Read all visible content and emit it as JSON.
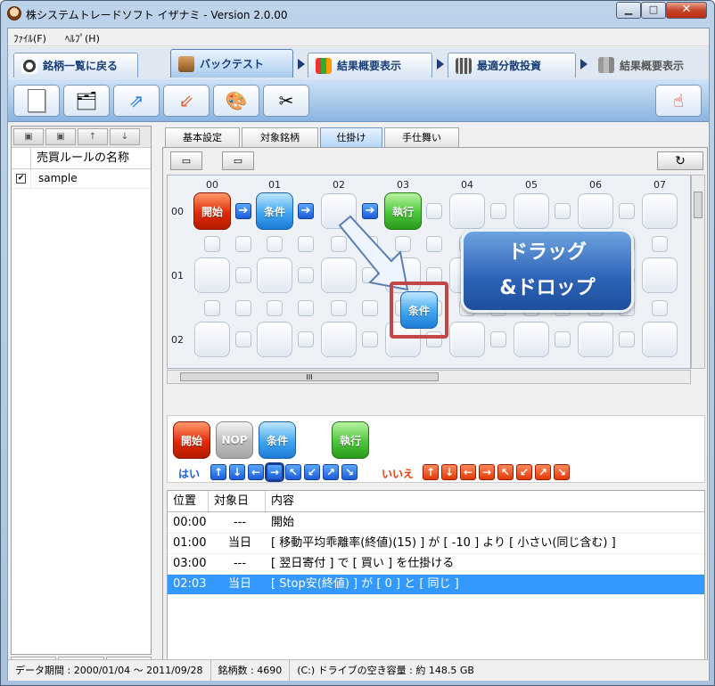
{
  "window": {
    "title": "株システムトレードソフト イザナミ - Version 2.0.00",
    "min_glyph": "▁",
    "max_glyph": "□",
    "close_glyph": "✕"
  },
  "menu": [
    "ﾌｧｲﾙ(F)",
    "ﾍﾙﾌﾟ(H)"
  ],
  "main_tabs": {
    "back": "銘柄一覧に戻る",
    "backtest": "バックテスト",
    "summary": "結果概要表示",
    "optimal": "最適分散投資",
    "summary2": "結果概要表示"
  },
  "left_panel": {
    "header": "売買ルールの名称",
    "rows": [
      {
        "checked": "✔",
        "name": "sample"
      }
    ],
    "bottom_add": "+",
    "bottom_trash": "🗑"
  },
  "sub_tabs": [
    "基本設定",
    "対象銘柄",
    "仕掛け",
    "手仕舞い"
  ],
  "grid": {
    "col_labels": [
      "00",
      "01",
      "02",
      "03",
      "04",
      "05",
      "06",
      "07"
    ],
    "row_labels": [
      "00",
      "01",
      "02"
    ],
    "node_start": "開始",
    "node_cond": "条件",
    "node_exec": "執行",
    "node_drag": "条件",
    "arrow": "➔",
    "scroll_mark": "III"
  },
  "callout": {
    "line1": "ドラッグ",
    "line2": "&ドロップ"
  },
  "palette": {
    "start": "開始",
    "nop": "NOP",
    "cond": "条件",
    "exec": "執行",
    "yes": "はい",
    "no": "いいえ",
    "arrows": [
      "↑",
      "↓",
      "←",
      "→",
      "↖",
      "↙",
      "↗",
      "↘"
    ]
  },
  "list": {
    "headers": [
      "位置",
      "対象日",
      "内容"
    ],
    "rows": [
      {
        "pos": "00:00",
        "day": "---",
        "content": "開始"
      },
      {
        "pos": "01:00",
        "day": "当日",
        "content": "[ 移動平均乖離率(終値)(15) ] が [ -10 ] より [ 小さい(同じ含む) ]"
      },
      {
        "pos": "03:00",
        "day": "---",
        "content": "[ 翌日寄付 ] で [ 買い ] を仕掛ける"
      },
      {
        "pos": "02:03",
        "day": "当日",
        "content": "[ Stop安(終値) ] が [ 0 ] と [ 同じ ]"
      }
    ]
  },
  "status": {
    "period": "データ期間 : 2000/01/04 ～ 2011/09/28",
    "count": "銘柄数 : 4690",
    "drive": "(C:) ドライブの空き容量 : 約 148.5 GB"
  }
}
